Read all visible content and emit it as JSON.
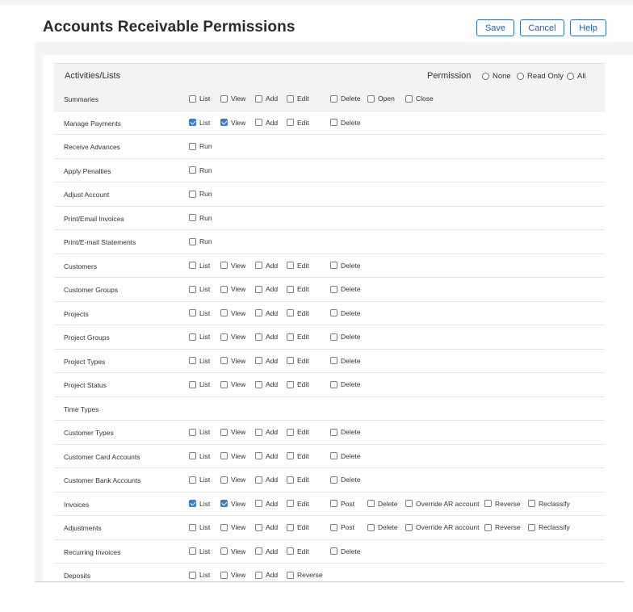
{
  "page": {
    "title": "Accounts Receivable Permissions",
    "buttons": {
      "save": "Save",
      "cancel": "Cancel",
      "help": "Help"
    }
  },
  "table": {
    "header_label": "Activities/Lists",
    "permission_label": "Permission",
    "radio": {
      "none": "None",
      "read_only": "Read Only",
      "all": "All"
    },
    "rows": [
      {
        "label": "Summaries",
        "options": [
          {
            "k": "list",
            "label": "List",
            "checked": false
          },
          {
            "k": "view",
            "label": "View",
            "checked": false
          },
          {
            "k": "add",
            "label": "Add",
            "checked": false
          },
          {
            "k": "edit",
            "label": "Edit",
            "checked": false
          },
          {
            "k": "delete",
            "label": "Delete",
            "checked": false
          },
          {
            "k": "open",
            "label": "Open",
            "checked": false
          },
          {
            "k": "close",
            "label": "Close",
            "checked": false
          }
        ]
      },
      {
        "label": "Manage Payments",
        "options": [
          {
            "k": "list",
            "label": "List",
            "checked": true
          },
          {
            "k": "view",
            "label": "View",
            "checked": true
          },
          {
            "k": "add",
            "label": "Add",
            "checked": false
          },
          {
            "k": "edit",
            "label": "Edit",
            "checked": false
          },
          {
            "k": "delete",
            "label": "Delete",
            "checked": false
          }
        ]
      },
      {
        "label": "Receive Advances",
        "options": [
          {
            "k": "run",
            "label": "Run",
            "checked": false
          }
        ]
      },
      {
        "label": "Apply Penalties",
        "options": [
          {
            "k": "run",
            "label": "Run",
            "checked": false
          }
        ]
      },
      {
        "label": "Adjust Account",
        "options": [
          {
            "k": "run",
            "label": "Run",
            "checked": false
          }
        ]
      },
      {
        "label": "Print/Email Invoices",
        "options": [
          {
            "k": "run",
            "label": "Run",
            "checked": false
          }
        ]
      },
      {
        "label": "Print/E-mail Statements",
        "options": [
          {
            "k": "run",
            "label": "Run",
            "checked": false
          }
        ]
      },
      {
        "label": "Customers",
        "options": [
          {
            "k": "list",
            "label": "List",
            "checked": false
          },
          {
            "k": "view",
            "label": "View",
            "checked": false
          },
          {
            "k": "add",
            "label": "Add",
            "checked": false
          },
          {
            "k": "edit",
            "label": "Edit",
            "checked": false
          },
          {
            "k": "delete",
            "label": "Delete",
            "checked": false
          }
        ]
      },
      {
        "label": "Customer Groups",
        "options": [
          {
            "k": "list",
            "label": "List",
            "checked": false
          },
          {
            "k": "view",
            "label": "View",
            "checked": false
          },
          {
            "k": "add",
            "label": "Add",
            "checked": false
          },
          {
            "k": "edit",
            "label": "Edit",
            "checked": false
          },
          {
            "k": "delete",
            "label": "Delete",
            "checked": false
          }
        ]
      },
      {
        "label": "Projects",
        "options": [
          {
            "k": "list",
            "label": "List",
            "checked": false
          },
          {
            "k": "view",
            "label": "View",
            "checked": false
          },
          {
            "k": "add",
            "label": "Add",
            "checked": false
          },
          {
            "k": "edit",
            "label": "Edit",
            "checked": false
          },
          {
            "k": "delete",
            "label": "Delete",
            "checked": false
          }
        ]
      },
      {
        "label": "Project Groups",
        "options": [
          {
            "k": "list",
            "label": "List",
            "checked": false
          },
          {
            "k": "view",
            "label": "View",
            "checked": false
          },
          {
            "k": "add",
            "label": "Add",
            "checked": false
          },
          {
            "k": "edit",
            "label": "Edit",
            "checked": false
          },
          {
            "k": "delete",
            "label": "Delete",
            "checked": false
          }
        ]
      },
      {
        "label": "Project Types",
        "options": [
          {
            "k": "list",
            "label": "List",
            "checked": false
          },
          {
            "k": "view",
            "label": "View",
            "checked": false
          },
          {
            "k": "add",
            "label": "Add",
            "checked": false
          },
          {
            "k": "edit",
            "label": "Edit",
            "checked": false
          },
          {
            "k": "delete",
            "label": "Delete",
            "checked": false
          }
        ]
      },
      {
        "label": "Project Status",
        "options": [
          {
            "k": "list",
            "label": "List",
            "checked": false
          },
          {
            "k": "view",
            "label": "View",
            "checked": false
          },
          {
            "k": "add",
            "label": "Add",
            "checked": false
          },
          {
            "k": "edit",
            "label": "Edit",
            "checked": false
          },
          {
            "k": "delete",
            "label": "Delete",
            "checked": false
          }
        ]
      },
      {
        "label": "Time Types",
        "options": []
      },
      {
        "label": "Customer Types",
        "options": [
          {
            "k": "list",
            "label": "List",
            "checked": false
          },
          {
            "k": "view",
            "label": "View",
            "checked": false
          },
          {
            "k": "add",
            "label": "Add",
            "checked": false
          },
          {
            "k": "edit",
            "label": "Edit",
            "checked": false
          },
          {
            "k": "delete",
            "label": "Delete",
            "checked": false
          }
        ]
      },
      {
        "label": "Customer Card Accounts",
        "options": [
          {
            "k": "list",
            "label": "List",
            "checked": false
          },
          {
            "k": "view",
            "label": "View",
            "checked": false
          },
          {
            "k": "add",
            "label": "Add",
            "checked": false
          },
          {
            "k": "edit",
            "label": "Edit",
            "checked": false
          },
          {
            "k": "delete",
            "label": "Delete",
            "checked": false
          }
        ]
      },
      {
        "label": "Customer Bank Accounts",
        "options": [
          {
            "k": "list",
            "label": "List",
            "checked": false
          },
          {
            "k": "view",
            "label": "View",
            "checked": false
          },
          {
            "k": "add",
            "label": "Add",
            "checked": false
          },
          {
            "k": "edit",
            "label": "Edit",
            "checked": false
          },
          {
            "k": "delete",
            "label": "Delete",
            "checked": false
          }
        ]
      },
      {
        "label": "Invoices",
        "options": [
          {
            "k": "list",
            "label": "List",
            "checked": true
          },
          {
            "k": "view",
            "label": "View",
            "checked": true
          },
          {
            "k": "add",
            "label": "Add",
            "checked": false
          },
          {
            "k": "edit",
            "label": "Edit",
            "checked": false
          },
          {
            "k": "post",
            "label": "Post",
            "checked": false
          },
          {
            "k": "delete2",
            "label": "Delete",
            "checked": false
          },
          {
            "k": "override",
            "label": "Override AR account",
            "checked": false
          },
          {
            "k": "reverse2",
            "label": "Reverse",
            "checked": false
          },
          {
            "k": "reclassify",
            "label": "Reclassify",
            "checked": false
          }
        ]
      },
      {
        "label": "Adjustments",
        "options": [
          {
            "k": "list",
            "label": "List",
            "checked": false
          },
          {
            "k": "view",
            "label": "View",
            "checked": false
          },
          {
            "k": "add",
            "label": "Add",
            "checked": false
          },
          {
            "k": "edit",
            "label": "Edit",
            "checked": false
          },
          {
            "k": "post",
            "label": "Post",
            "checked": false
          },
          {
            "k": "delete2",
            "label": "Delete",
            "checked": false
          },
          {
            "k": "override",
            "label": "Override AR account",
            "checked": false
          },
          {
            "k": "reverse2",
            "label": "Reverse",
            "checked": false
          },
          {
            "k": "reclassify",
            "label": "Reclassify",
            "checked": false
          }
        ]
      },
      {
        "label": "Recurring Invoices",
        "options": [
          {
            "k": "list",
            "label": "List",
            "checked": false
          },
          {
            "k": "view",
            "label": "View",
            "checked": false
          },
          {
            "k": "add",
            "label": "Add",
            "checked": false
          },
          {
            "k": "edit",
            "label": "Edit",
            "checked": false
          },
          {
            "k": "delete",
            "label": "Delete",
            "checked": false
          }
        ]
      },
      {
        "label": "Deposits",
        "options": [
          {
            "k": "list",
            "label": "List",
            "checked": false
          },
          {
            "k": "view",
            "label": "View",
            "checked": false
          },
          {
            "k": "add",
            "label": "Add",
            "checked": false
          },
          {
            "k": "reverse",
            "label": "Reverse",
            "checked": false
          }
        ]
      }
    ]
  }
}
